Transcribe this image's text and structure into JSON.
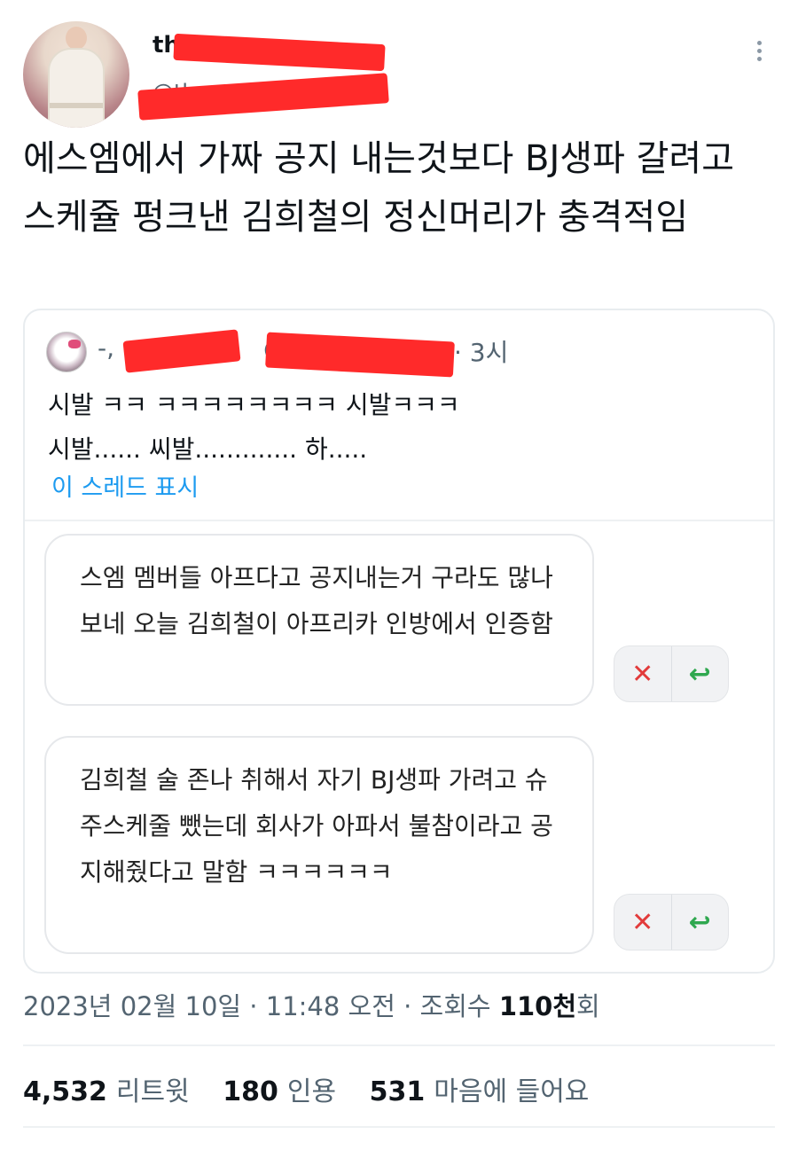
{
  "author": {
    "display_name": "th",
    "handle": "@th"
  },
  "tweet": {
    "text": "에스엠에서 가짜 공지 내는것보다 BJ생파 갈려고 스케쥴 펑크낸 김희철의 정신머리가 충격적임"
  },
  "quoted": {
    "name_prefix": "-,",
    "handle_prefix": "@",
    "time": "· 3시",
    "line1": "시발 ㅋㅋ ㅋㅋㅋㅋㅋㅋㅋㅋ 시발ㅋㅋㅋ",
    "line2": "시발...... 씨발............. 하.....",
    "show_thread": "이 스레드 표시",
    "messages": [
      {
        "text": "스엠 멤버들 아프다고 공지내는거 구라도 많나보네 오늘 김희철이 아프리카 인방에서 인증함"
      },
      {
        "text": "김희철 술 존나 취해서 자기 BJ생파 가려고 슈주스케줄 뺐는데 회사가 아파서 불참이라고 공지해줬다고 말함 ㅋㅋㅋㅋㅋㅋ"
      }
    ],
    "reject_symbol": "✕",
    "reply_symbol": "↩"
  },
  "meta": {
    "date_time": "2023년 02월 10일 · 11:48 오전 · 조회수 ",
    "views": "110천",
    "views_suffix": "회"
  },
  "stats": {
    "retweets_count": "4,532",
    "retweets_label": "리트윗",
    "quotes_count": "180",
    "quotes_label": "인용",
    "likes_count": "531",
    "likes_label": "마음에 들어요"
  },
  "colors": {
    "link": "#1d9bf0",
    "redaction": "#ff2a2a",
    "reject": "#e23b3b",
    "reply": "#2fa84f"
  }
}
